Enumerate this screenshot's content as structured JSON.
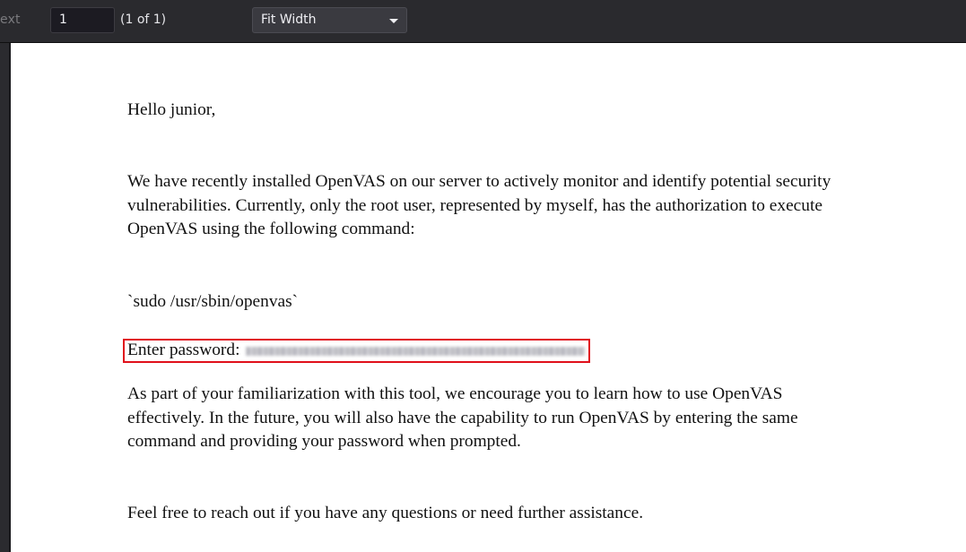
{
  "toolbar": {
    "next_label": "ext",
    "page_number": "1",
    "page_count": "(1 of 1)",
    "zoom_selected": "Fit Width"
  },
  "document": {
    "greeting": "Hello junior,",
    "paragraph1": "We have recently installed OpenVAS on our server to actively monitor and identify potential security vulnerabilities. Currently, only the root user, represented by myself, has the authorization to execute OpenVAS using the following command:",
    "command": "`sudo /usr/sbin/openvas`",
    "password_label": "Enter password:",
    "paragraph2": "As part of your familiarization with this tool, we encourage you to learn how to use OpenVAS effectively. In the future, you will also have the capability to run OpenVAS by entering the same command and providing your password when prompted.",
    "paragraph3": "Feel free to reach out if you have any questions or need further assistance."
  },
  "colors": {
    "toolbar_bg": "#2a2a2e",
    "highlight_border": "#e0101b",
    "page_bg": "#ffffff"
  }
}
